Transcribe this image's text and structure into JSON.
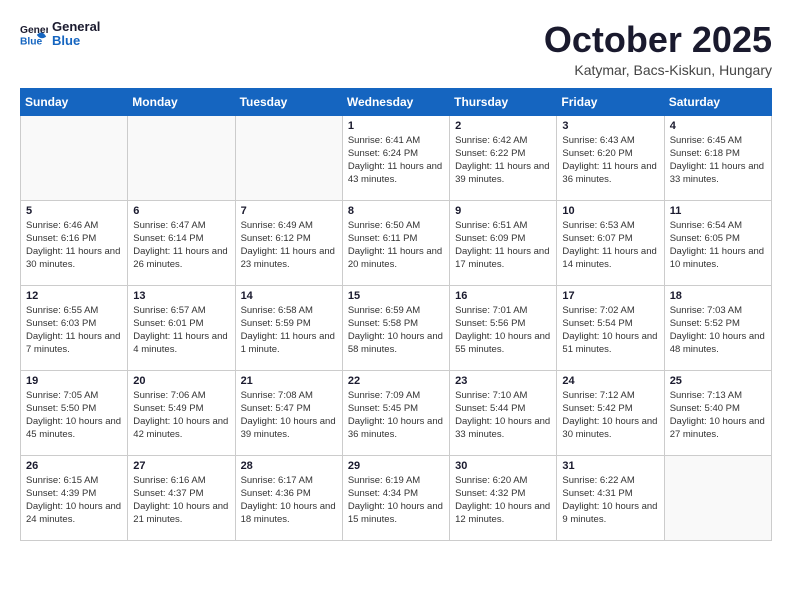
{
  "header": {
    "logo_general": "General",
    "logo_blue": "Blue",
    "month_title": "October 2025",
    "location": "Katymar, Bacs-Kiskun, Hungary"
  },
  "weekdays": [
    "Sunday",
    "Monday",
    "Tuesday",
    "Wednesday",
    "Thursday",
    "Friday",
    "Saturday"
  ],
  "weeks": [
    [
      {
        "day": "",
        "sunrise": "",
        "sunset": "",
        "daylight": ""
      },
      {
        "day": "",
        "sunrise": "",
        "sunset": "",
        "daylight": ""
      },
      {
        "day": "",
        "sunrise": "",
        "sunset": "",
        "daylight": ""
      },
      {
        "day": "1",
        "sunrise": "Sunrise: 6:41 AM",
        "sunset": "Sunset: 6:24 PM",
        "daylight": "Daylight: 11 hours and 43 minutes."
      },
      {
        "day": "2",
        "sunrise": "Sunrise: 6:42 AM",
        "sunset": "Sunset: 6:22 PM",
        "daylight": "Daylight: 11 hours and 39 minutes."
      },
      {
        "day": "3",
        "sunrise": "Sunrise: 6:43 AM",
        "sunset": "Sunset: 6:20 PM",
        "daylight": "Daylight: 11 hours and 36 minutes."
      },
      {
        "day": "4",
        "sunrise": "Sunrise: 6:45 AM",
        "sunset": "Sunset: 6:18 PM",
        "daylight": "Daylight: 11 hours and 33 minutes."
      }
    ],
    [
      {
        "day": "5",
        "sunrise": "Sunrise: 6:46 AM",
        "sunset": "Sunset: 6:16 PM",
        "daylight": "Daylight: 11 hours and 30 minutes."
      },
      {
        "day": "6",
        "sunrise": "Sunrise: 6:47 AM",
        "sunset": "Sunset: 6:14 PM",
        "daylight": "Daylight: 11 hours and 26 minutes."
      },
      {
        "day": "7",
        "sunrise": "Sunrise: 6:49 AM",
        "sunset": "Sunset: 6:12 PM",
        "daylight": "Daylight: 11 hours and 23 minutes."
      },
      {
        "day": "8",
        "sunrise": "Sunrise: 6:50 AM",
        "sunset": "Sunset: 6:11 PM",
        "daylight": "Daylight: 11 hours and 20 minutes."
      },
      {
        "day": "9",
        "sunrise": "Sunrise: 6:51 AM",
        "sunset": "Sunset: 6:09 PM",
        "daylight": "Daylight: 11 hours and 17 minutes."
      },
      {
        "day": "10",
        "sunrise": "Sunrise: 6:53 AM",
        "sunset": "Sunset: 6:07 PM",
        "daylight": "Daylight: 11 hours and 14 minutes."
      },
      {
        "day": "11",
        "sunrise": "Sunrise: 6:54 AM",
        "sunset": "Sunset: 6:05 PM",
        "daylight": "Daylight: 11 hours and 10 minutes."
      }
    ],
    [
      {
        "day": "12",
        "sunrise": "Sunrise: 6:55 AM",
        "sunset": "Sunset: 6:03 PM",
        "daylight": "Daylight: 11 hours and 7 minutes."
      },
      {
        "day": "13",
        "sunrise": "Sunrise: 6:57 AM",
        "sunset": "Sunset: 6:01 PM",
        "daylight": "Daylight: 11 hours and 4 minutes."
      },
      {
        "day": "14",
        "sunrise": "Sunrise: 6:58 AM",
        "sunset": "Sunset: 5:59 PM",
        "daylight": "Daylight: 11 hours and 1 minute."
      },
      {
        "day": "15",
        "sunrise": "Sunrise: 6:59 AM",
        "sunset": "Sunset: 5:58 PM",
        "daylight": "Daylight: 10 hours and 58 minutes."
      },
      {
        "day": "16",
        "sunrise": "Sunrise: 7:01 AM",
        "sunset": "Sunset: 5:56 PM",
        "daylight": "Daylight: 10 hours and 55 minutes."
      },
      {
        "day": "17",
        "sunrise": "Sunrise: 7:02 AM",
        "sunset": "Sunset: 5:54 PM",
        "daylight": "Daylight: 10 hours and 51 minutes."
      },
      {
        "day": "18",
        "sunrise": "Sunrise: 7:03 AM",
        "sunset": "Sunset: 5:52 PM",
        "daylight": "Daylight: 10 hours and 48 minutes."
      }
    ],
    [
      {
        "day": "19",
        "sunrise": "Sunrise: 7:05 AM",
        "sunset": "Sunset: 5:50 PM",
        "daylight": "Daylight: 10 hours and 45 minutes."
      },
      {
        "day": "20",
        "sunrise": "Sunrise: 7:06 AM",
        "sunset": "Sunset: 5:49 PM",
        "daylight": "Daylight: 10 hours and 42 minutes."
      },
      {
        "day": "21",
        "sunrise": "Sunrise: 7:08 AM",
        "sunset": "Sunset: 5:47 PM",
        "daylight": "Daylight: 10 hours and 39 minutes."
      },
      {
        "day": "22",
        "sunrise": "Sunrise: 7:09 AM",
        "sunset": "Sunset: 5:45 PM",
        "daylight": "Daylight: 10 hours and 36 minutes."
      },
      {
        "day": "23",
        "sunrise": "Sunrise: 7:10 AM",
        "sunset": "Sunset: 5:44 PM",
        "daylight": "Daylight: 10 hours and 33 minutes."
      },
      {
        "day": "24",
        "sunrise": "Sunrise: 7:12 AM",
        "sunset": "Sunset: 5:42 PM",
        "daylight": "Daylight: 10 hours and 30 minutes."
      },
      {
        "day": "25",
        "sunrise": "Sunrise: 7:13 AM",
        "sunset": "Sunset: 5:40 PM",
        "daylight": "Daylight: 10 hours and 27 minutes."
      }
    ],
    [
      {
        "day": "26",
        "sunrise": "Sunrise: 6:15 AM",
        "sunset": "Sunset: 4:39 PM",
        "daylight": "Daylight: 10 hours and 24 minutes."
      },
      {
        "day": "27",
        "sunrise": "Sunrise: 6:16 AM",
        "sunset": "Sunset: 4:37 PM",
        "daylight": "Daylight: 10 hours and 21 minutes."
      },
      {
        "day": "28",
        "sunrise": "Sunrise: 6:17 AM",
        "sunset": "Sunset: 4:36 PM",
        "daylight": "Daylight: 10 hours and 18 minutes."
      },
      {
        "day": "29",
        "sunrise": "Sunrise: 6:19 AM",
        "sunset": "Sunset: 4:34 PM",
        "daylight": "Daylight: 10 hours and 15 minutes."
      },
      {
        "day": "30",
        "sunrise": "Sunrise: 6:20 AM",
        "sunset": "Sunset: 4:32 PM",
        "daylight": "Daylight: 10 hours and 12 minutes."
      },
      {
        "day": "31",
        "sunrise": "Sunrise: 6:22 AM",
        "sunset": "Sunset: 4:31 PM",
        "daylight": "Daylight: 10 hours and 9 minutes."
      },
      {
        "day": "",
        "sunrise": "",
        "sunset": "",
        "daylight": ""
      }
    ]
  ]
}
